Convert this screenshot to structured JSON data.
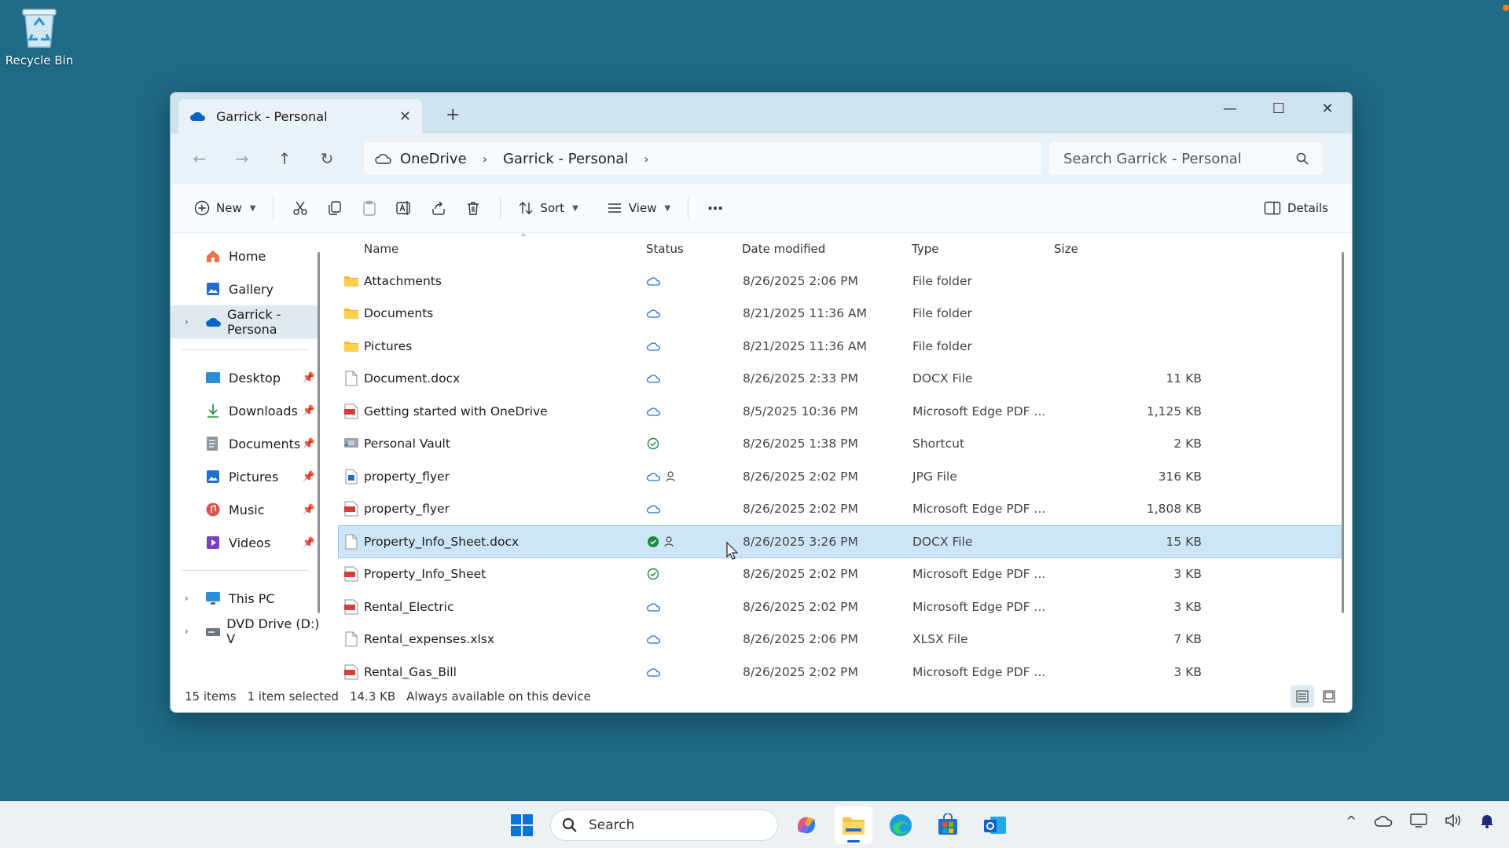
{
  "desktop": {
    "recycle_bin_label": "Recycle Bin"
  },
  "window": {
    "tab_title": "Garrick - Personal",
    "address": {
      "crumbs": [
        "OneDrive",
        "Garrick - Personal"
      ]
    },
    "search_placeholder": "Search Garrick - Personal",
    "toolbar": {
      "new_label": "New",
      "sort_label": "Sort",
      "view_label": "View",
      "details_label": "Details"
    },
    "sidebar": {
      "home": "Home",
      "gallery": "Gallery",
      "onedrive": "Garrick - Persona",
      "desktop": "Desktop",
      "downloads": "Downloads",
      "documents": "Documents",
      "pictures": "Pictures",
      "music": "Music",
      "videos": "Videos",
      "this_pc": "This PC",
      "dvd_drive": "DVD Drive (D:) V"
    },
    "columns": {
      "name": "Name",
      "status": "Status",
      "date": "Date modified",
      "type": "Type",
      "size": "Size"
    },
    "rows": [
      {
        "name": "Attachments",
        "icon": "folder-icon",
        "status": "cloud",
        "shared": false,
        "date": "8/26/2025 2:06 PM",
        "type": "File folder",
        "size": ""
      },
      {
        "name": "Documents",
        "icon": "folder-icon",
        "status": "cloud",
        "shared": false,
        "date": "8/21/2025 11:36 AM",
        "type": "File folder",
        "size": ""
      },
      {
        "name": "Pictures",
        "icon": "folder-icon",
        "status": "cloud",
        "shared": false,
        "date": "8/21/2025 11:36 AM",
        "type": "File folder",
        "size": ""
      },
      {
        "name": "Document.docx",
        "icon": "document-icon",
        "status": "cloud",
        "shared": false,
        "date": "8/26/2025 2:33 PM",
        "type": "DOCX File",
        "size": "11 KB"
      },
      {
        "name": "Getting started with OneDrive",
        "icon": "pdf-icon",
        "status": "cloud",
        "shared": false,
        "date": "8/5/2025 10:36 PM",
        "type": "Microsoft Edge PDF ...",
        "size": "1,125 KB"
      },
      {
        "name": "Personal Vault",
        "icon": "shortcut-icon",
        "status": "available",
        "shared": false,
        "date": "8/26/2025 1:38 PM",
        "type": "Shortcut",
        "size": "2 KB"
      },
      {
        "name": "property_flyer",
        "icon": "image-file-icon",
        "status": "cloud",
        "shared": true,
        "date": "8/26/2025 2:02 PM",
        "type": "JPG File",
        "size": "316 KB"
      },
      {
        "name": "property_flyer",
        "icon": "pdf-icon",
        "status": "cloud",
        "shared": false,
        "date": "8/26/2025 2:02 PM",
        "type": "Microsoft Edge PDF ...",
        "size": "1,808 KB"
      },
      {
        "name": "Property_Info_Sheet.docx",
        "icon": "document-icon",
        "status": "always",
        "shared": true,
        "date": "8/26/2025 3:26 PM",
        "type": "DOCX File",
        "size": "15 KB",
        "selected": true
      },
      {
        "name": "Property_Info_Sheet",
        "icon": "pdf-icon",
        "status": "available",
        "shared": false,
        "date": "8/26/2025 2:02 PM",
        "type": "Microsoft Edge PDF ...",
        "size": "3 KB"
      },
      {
        "name": "Rental_Electric",
        "icon": "pdf-icon",
        "status": "cloud",
        "shared": false,
        "date": "8/26/2025 2:02 PM",
        "type": "Microsoft Edge PDF ...",
        "size": "3 KB"
      },
      {
        "name": "Rental_expenses.xlsx",
        "icon": "document-icon",
        "status": "cloud",
        "shared": false,
        "date": "8/26/2025 2:06 PM",
        "type": "XLSX File",
        "size": "7 KB"
      },
      {
        "name": "Rental_Gas_Bill",
        "icon": "pdf-icon",
        "status": "cloud",
        "shared": false,
        "date": "8/26/2025 2:02 PM",
        "type": "Microsoft Edge PDF ...",
        "size": "3 KB"
      }
    ],
    "statusbar": {
      "items": "15 items",
      "selected": "1 item selected",
      "size": "14.3 KB",
      "availability": "Always available on this device"
    }
  },
  "taskbar": {
    "search_label": "Search"
  },
  "colors": {
    "desktop_bg": "#1f6a86",
    "accent": "#0a64c4",
    "selection": "#cde6f7",
    "status_green": "#1e8c3a"
  }
}
